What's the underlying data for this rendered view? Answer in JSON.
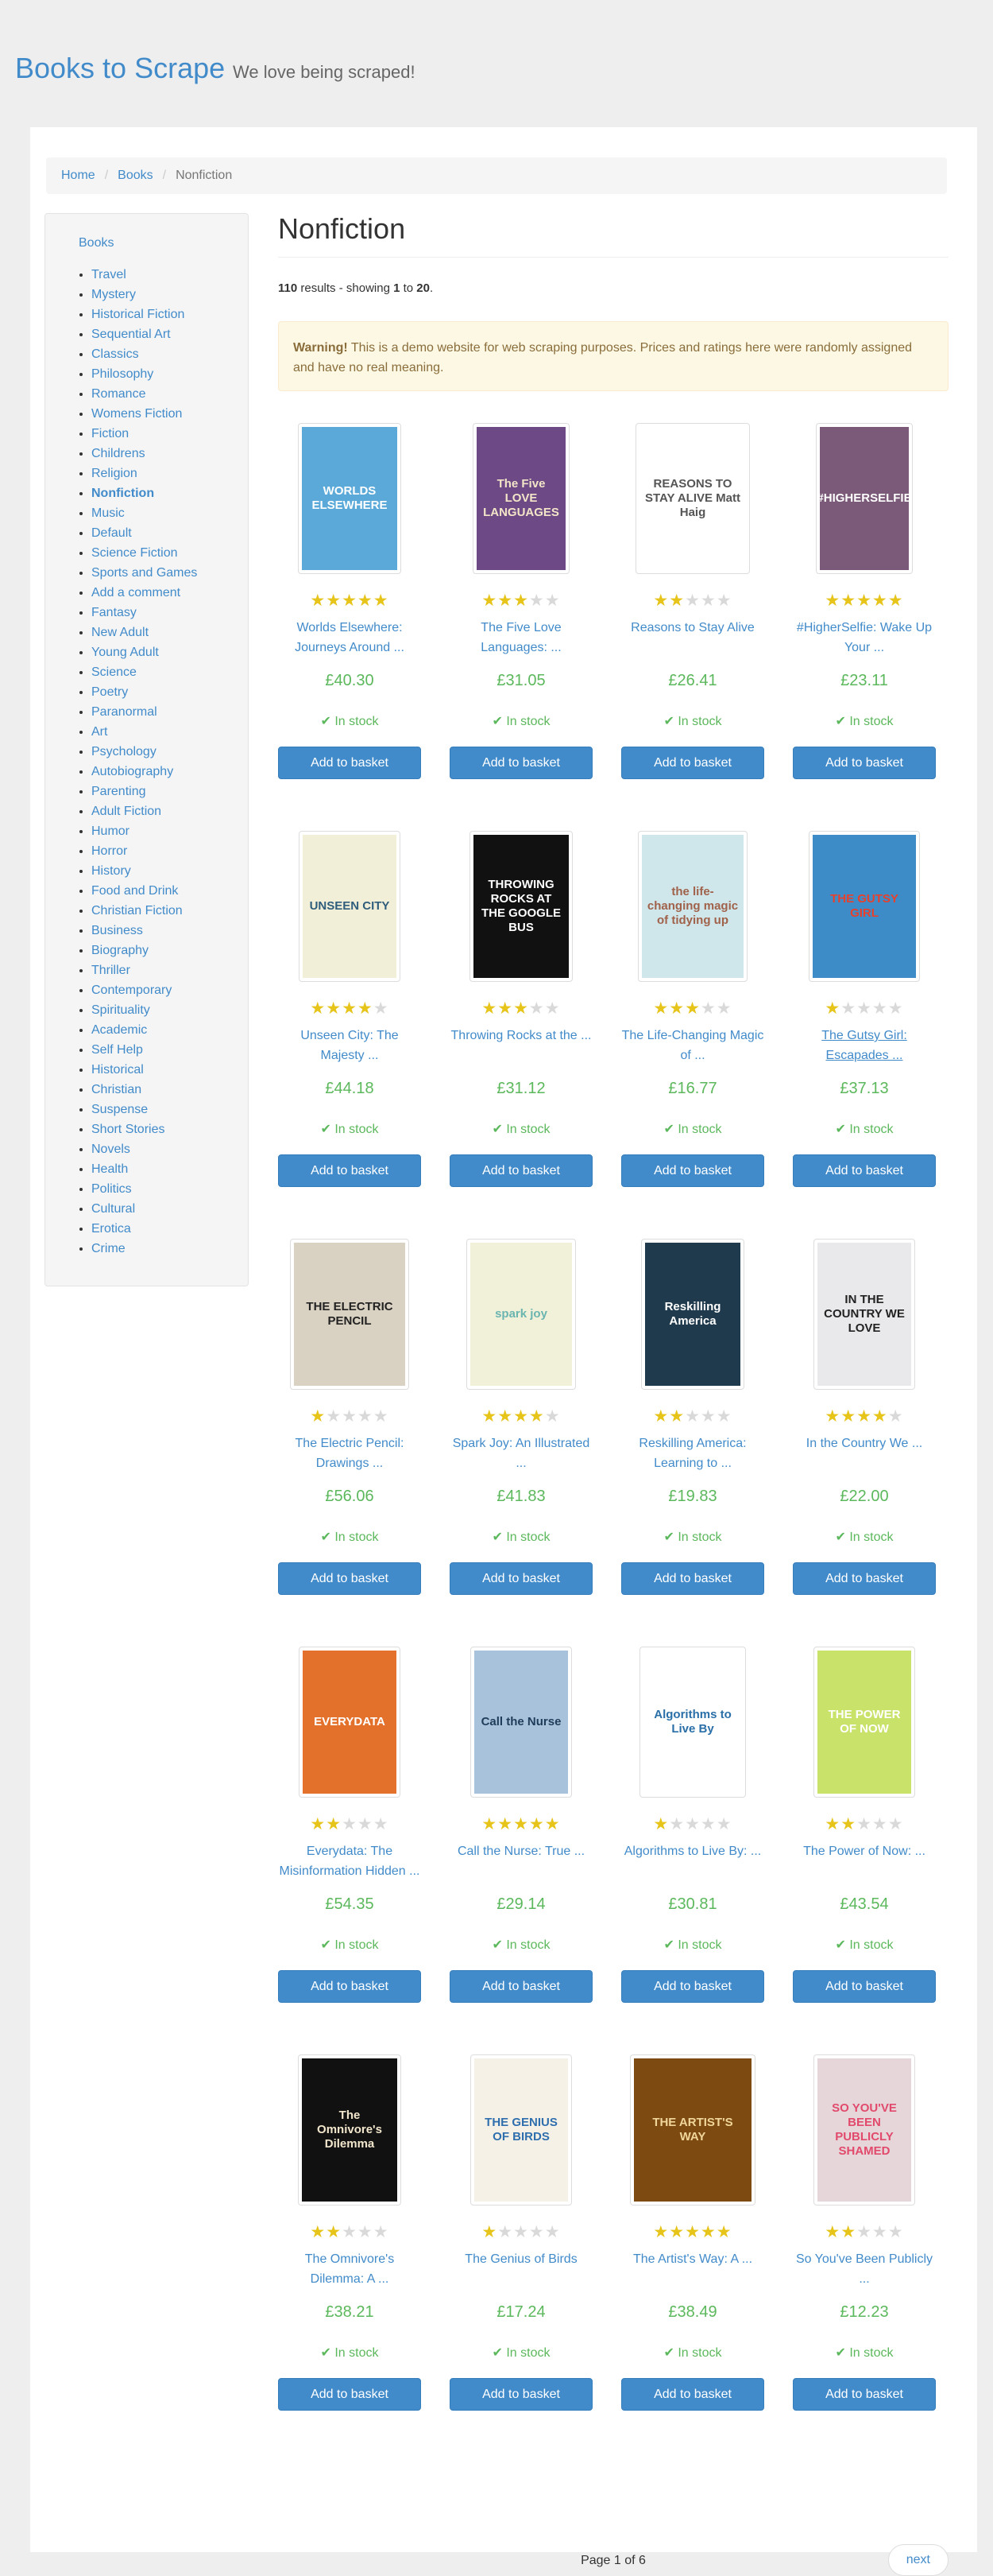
{
  "header": {
    "site_name": "Books to Scrape",
    "tagline": "We love being scraped!"
  },
  "breadcrumb": {
    "home": "Home",
    "books": "Books",
    "current": "Nonfiction"
  },
  "sidebar": {
    "top": "Books",
    "categories": [
      "Travel",
      "Mystery",
      "Historical Fiction",
      "Sequential Art",
      "Classics",
      "Philosophy",
      "Romance",
      "Womens Fiction",
      "Fiction",
      "Childrens",
      "Religion",
      "Nonfiction",
      "Music",
      "Default",
      "Science Fiction",
      "Sports and Games",
      "Add a comment",
      "Fantasy",
      "New Adult",
      "Young Adult",
      "Science",
      "Poetry",
      "Paranormal",
      "Art",
      "Psychology",
      "Autobiography",
      "Parenting",
      "Adult Fiction",
      "Humor",
      "Horror",
      "History",
      "Food and Drink",
      "Christian Fiction",
      "Business",
      "Biography",
      "Thriller",
      "Contemporary",
      "Spirituality",
      "Academic",
      "Self Help",
      "Historical",
      "Christian",
      "Suspense",
      "Short Stories",
      "Novels",
      "Health",
      "Politics",
      "Cultural",
      "Erotica",
      "Crime"
    ],
    "active": "Nonfiction"
  },
  "main": {
    "heading": "Nonfiction",
    "results": {
      "count": "110",
      "mid": "results - showing",
      "from": "1",
      "to_word": "to",
      "to": "20"
    },
    "warning": {
      "strong": "Warning!",
      "text": "This is a demo website for web scraping purposes. Prices and ratings here were randomly assigned and have no real meaning."
    }
  },
  "labels": {
    "in_stock": "In stock",
    "add_to_basket": "Add to basket"
  },
  "colors": {
    "link": "#428bca",
    "price": "#5cb85c",
    "star": "#e6c41a",
    "button": "#428bca"
  },
  "books": [
    {
      "title": "Worlds Elsewhere: Journeys Around ...",
      "price": "£40.30",
      "rating": 5,
      "cover": {
        "bg": "#5aa9d8",
        "fg": "#ffffff",
        "text": "WORLDS ELSEWHERE",
        "w": 130
      }
    },
    {
      "title": "The Five Love Languages: ...",
      "price": "£31.05",
      "rating": 3,
      "cover": {
        "bg": "#6d4a86",
        "fg": "#f3e6c8",
        "text": "The Five LOVE LANGUAGES",
        "w": 122
      }
    },
    {
      "title": "Reasons to Stay Alive",
      "price": "£26.41",
      "rating": 2,
      "cover": {
        "bg": "#ffffff",
        "fg": "#555555",
        "text": "REASONS TO STAY ALIVE Matt Haig",
        "w": 144
      }
    },
    {
      "title": "#HigherSelfie: Wake Up Your ...",
      "price": "£23.11",
      "rating": 5,
      "cover": {
        "bg": "#7a5a78",
        "fg": "#ffffff",
        "text": "#HIGHERSELFIE",
        "w": 122
      }
    },
    {
      "title": "Unseen City: The Majesty ...",
      "price": "£44.18",
      "rating": 4,
      "cover": {
        "bg": "#f2efd8",
        "fg": "#2f5d7c",
        "text": "UNSEEN CITY",
        "w": 128
      }
    },
    {
      "title": "Throwing Rocks at the ...",
      "price": "£31.12",
      "rating": 3,
      "cover": {
        "bg": "#111111",
        "fg": "#ffffff",
        "text": "THROWING ROCKS AT THE GOOGLE BUS",
        "w": 130
      }
    },
    {
      "title": "The Life-Changing Magic of ...",
      "price": "£16.77",
      "rating": 3,
      "cover": {
        "bg": "#cfe6ea",
        "fg": "#a0624a",
        "text": "the life-changing magic of tidying up",
        "w": 138
      }
    },
    {
      "title": "The Gutsy Girl: Escapades ...",
      "price": "£37.13",
      "rating": 1,
      "cover": {
        "bg": "#3d8cc8",
        "fg": "#e8402a",
        "text": "THE GUTSY GIRL",
        "w": 140
      },
      "underline": true
    },
    {
      "title": "The Electric Pencil: Drawings ...",
      "price": "£56.06",
      "rating": 1,
      "cover": {
        "bg": "#d9d2c2",
        "fg": "#222222",
        "text": "THE ELECTRIC PENCIL",
        "w": 150
      }
    },
    {
      "title": "Spark Joy: An Illustrated ...",
      "price": "£41.83",
      "rating": 4,
      "cover": {
        "bg": "#f1f0d8",
        "fg": "#6ab5b0",
        "text": "spark joy",
        "w": 138
      }
    },
    {
      "title": "Reskilling America: Learning to ...",
      "price": "£19.83",
      "rating": 2,
      "cover": {
        "bg": "#1f3a4d",
        "fg": "#ffffff",
        "text": "Reskilling America",
        "w": 130
      }
    },
    {
      "title": "In the Country We ...",
      "price": "£22.00",
      "rating": 4,
      "cover": {
        "bg": "#e9e9ec",
        "fg": "#222222",
        "text": "IN THE COUNTRY WE LOVE",
        "w": 128
      }
    },
    {
      "title": "Everydata: The Misinformation Hidden ...",
      "price": "£54.35",
      "rating": 2,
      "cover": {
        "bg": "#e3702b",
        "fg": "#ffffff",
        "text": "EVERYDATA",
        "w": 128
      }
    },
    {
      "title": "Call the Nurse: True ...",
      "price": "£29.14",
      "rating": 5,
      "cover": {
        "bg": "#a7c2da",
        "fg": "#1f3c5a",
        "text": "Call the Nurse",
        "w": 128
      }
    },
    {
      "title": "Algorithms to Live By: ...",
      "price": "£30.81",
      "rating": 1,
      "cover": {
        "bg": "#ffffff",
        "fg": "#2a6fa8",
        "text": "Algorithms to Live By",
        "w": 134
      }
    },
    {
      "title": "The Power of Now: ...",
      "price": "£43.54",
      "rating": 2,
      "cover": {
        "bg": "#c9e26a",
        "fg": "#ffffff",
        "text": "THE POWER OF NOW",
        "w": 128
      }
    },
    {
      "title": "The Omnivore's Dilemma: A ...",
      "price": "£38.21",
      "rating": 2,
      "cover": {
        "bg": "#111111",
        "fg": "#f2e6cc",
        "text": "The Omnivore's Dilemma",
        "w": 130
      }
    },
    {
      "title": "The Genius of Birds",
      "price": "£17.24",
      "rating": 1,
      "cover": {
        "bg": "#f5f1e6",
        "fg": "#2f6fae",
        "text": "THE GENIUS OF BIRDS",
        "w": 128
      }
    },
    {
      "title": "The Artist's Way: A ...",
      "price": "£38.49",
      "rating": 5,
      "cover": {
        "bg": "#7d4a12",
        "fg": "#f0d69a",
        "text": "THE ARTIST'S WAY",
        "w": 158
      }
    },
    {
      "title": "So You've Been Publicly ...",
      "price": "£12.23",
      "rating": 2,
      "cover": {
        "bg": "#e7d6d9",
        "fg": "#e14a6c",
        "text": "SO YOU'VE BEEN PUBLICLY SHAMED",
        "w": 128
      }
    }
  ],
  "pager": {
    "current": "Page 1 of 6",
    "next": "next"
  }
}
